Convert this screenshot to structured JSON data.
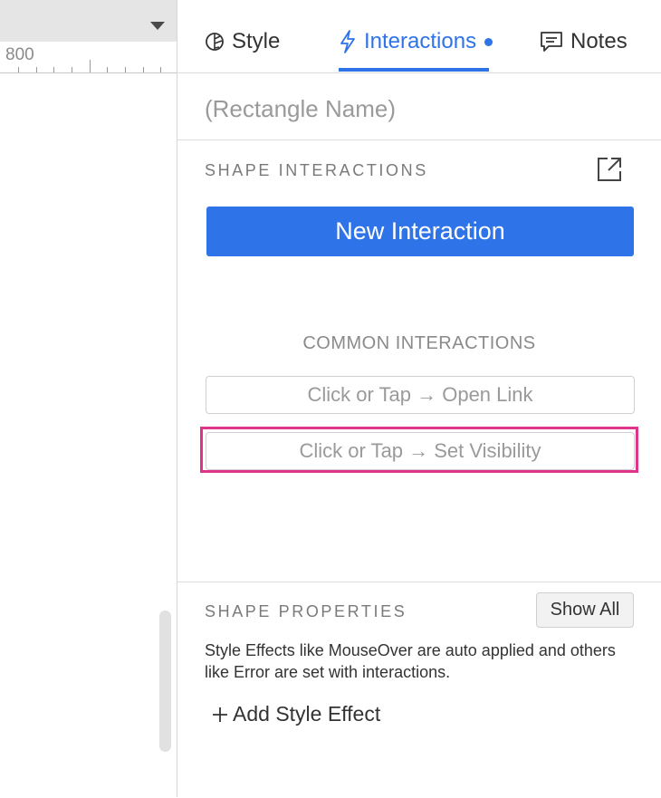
{
  "ruler": {
    "value": "800"
  },
  "tabs": {
    "style": "Style",
    "interactions": "Interactions",
    "notes": "Notes"
  },
  "shape": {
    "name": "(Rectangle Name)"
  },
  "shape_interactions": {
    "title": "SHAPE INTERACTIONS",
    "new_button": "New Interaction"
  },
  "common_interactions": {
    "title": "COMMON INTERACTIONS",
    "items": [
      "Click or Tap → Open Link",
      "Click or Tap → Set Visibility"
    ]
  },
  "shape_properties": {
    "title": "SHAPE PROPERTIES",
    "show_all": "Show All",
    "description": "Style Effects like MouseOver are auto applied and others like Error are set with interactions.",
    "add_effect": "Add Style Effect"
  },
  "colors": {
    "accent": "#2f73e8",
    "highlight": "#e0338a"
  },
  "icons": [
    "style-icon",
    "interactions-icon",
    "notes-icon",
    "popout-icon",
    "plus-icon",
    "dropdown-caret-icon"
  ]
}
